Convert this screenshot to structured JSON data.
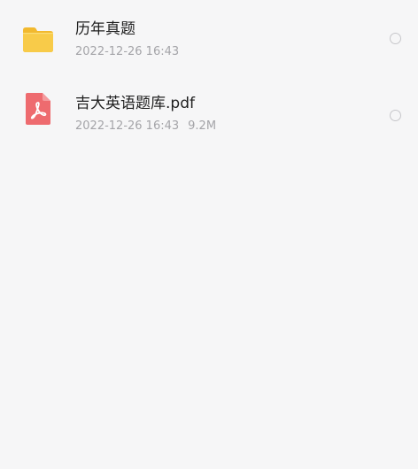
{
  "files": [
    {
      "name": "历年真题",
      "date": "2022-12-26 16:43",
      "size": "",
      "type_icon": "folder-icon",
      "icon_color": "#f7c43f"
    },
    {
      "name": "吉大英语题库.pdf",
      "date": "2022-12-26 16:43",
      "size": "9.2M",
      "type_icon": "pdf-file-icon",
      "icon_color": "#ee6b6f"
    }
  ],
  "colors": {
    "background": "#f6f6f7",
    "primary_text": "#1f1f1f",
    "secondary_text": "#a4a4a8",
    "radio_border": "#c6c6ca"
  }
}
